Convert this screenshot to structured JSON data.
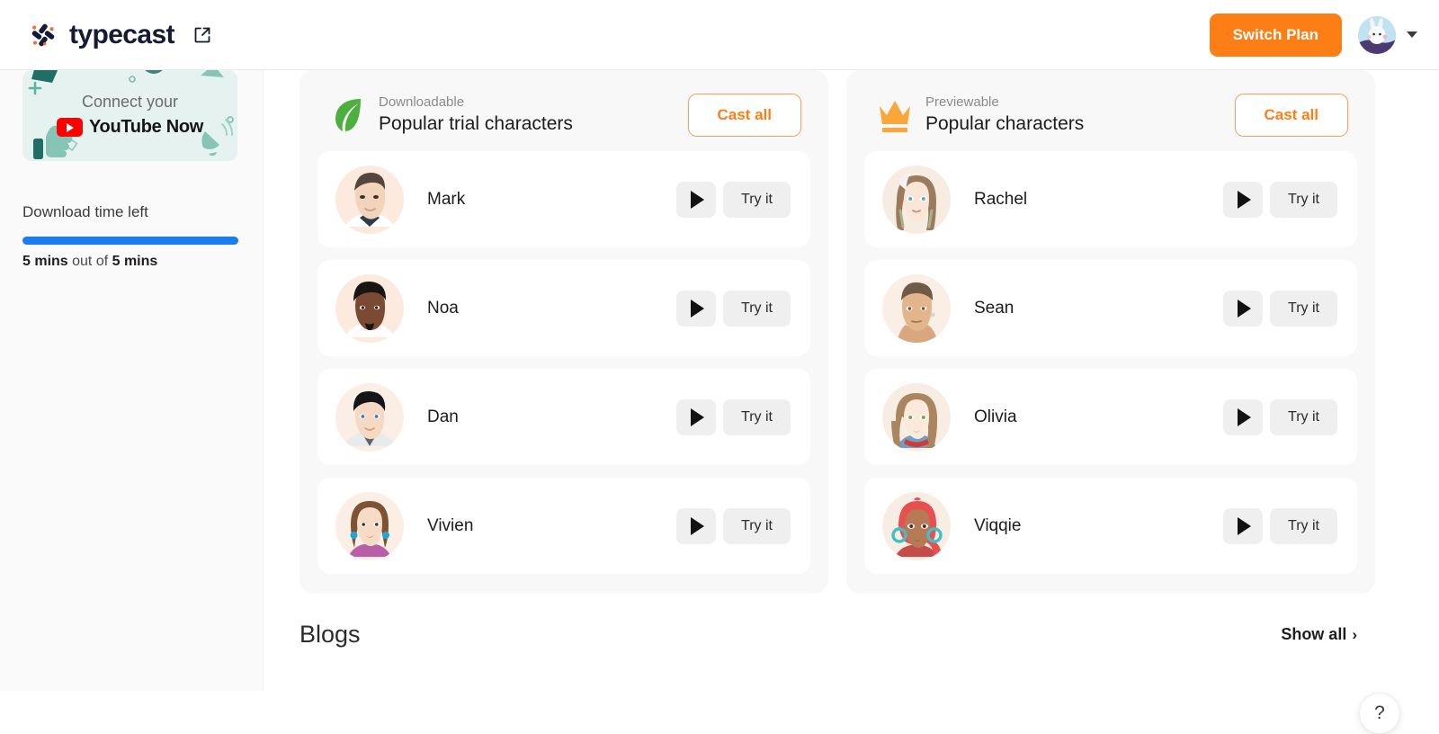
{
  "header": {
    "brand_name": "typecast",
    "brand_mark_icon": "typecast-pinwheel-logo",
    "external_link_icon": "external-link-icon",
    "switch_plan_label": "Switch Plan",
    "avatar_icon": "user-avatar-rabbit",
    "caret_icon": "chevron-down-icon",
    "accent_color": "#fd7e14"
  },
  "sidebar": {
    "banner": {
      "line1": "Connect your",
      "line2": "YouTube Now",
      "youtube_icon": "youtube-play-icon",
      "background_color": "#e6f2ef"
    },
    "download": {
      "label": "Download time left",
      "progress_percent": 100,
      "progress_color": "#1a7cf5",
      "status_used": "5 mins",
      "status_middle": " out of ",
      "status_total": "5 mins"
    }
  },
  "main": {
    "cards": [
      {
        "icon": "leaf-icon",
        "icon_color": "#4caf3e",
        "kicker": "Downloadable",
        "title": "Popular trial characters",
        "cast_all_label": "Cast all",
        "characters": [
          {
            "name": "Mark",
            "avatar_icon": "avatar-mark",
            "play_label": "play-icon",
            "try_label": "Try it"
          },
          {
            "name": "Noa",
            "avatar_icon": "avatar-noa",
            "play_label": "play-icon",
            "try_label": "Try it"
          },
          {
            "name": "Dan",
            "avatar_icon": "avatar-dan",
            "play_label": "play-icon",
            "try_label": "Try it"
          },
          {
            "name": "Vivien",
            "avatar_icon": "avatar-vivien",
            "play_label": "play-icon",
            "try_label": "Try it"
          }
        ]
      },
      {
        "icon": "crown-icon",
        "icon_color": "#f9a63a",
        "kicker": "Previewable",
        "title": "Popular characters",
        "cast_all_label": "Cast all",
        "characters": [
          {
            "name": "Rachel",
            "avatar_icon": "avatar-rachel",
            "play_label": "play-icon",
            "try_label": "Try it"
          },
          {
            "name": "Sean",
            "avatar_icon": "avatar-sean",
            "play_label": "play-icon",
            "try_label": "Try it"
          },
          {
            "name": "Olivia",
            "avatar_icon": "avatar-olivia",
            "play_label": "play-icon",
            "try_label": "Try it"
          },
          {
            "name": "Viqqie",
            "avatar_icon": "avatar-viqqie",
            "play_label": "play-icon",
            "try_label": "Try it"
          }
        ]
      }
    ],
    "blogs": {
      "title": "Blogs",
      "show_all_label": "Show all",
      "show_all_chevron": "›"
    },
    "help_button_label": "?"
  }
}
